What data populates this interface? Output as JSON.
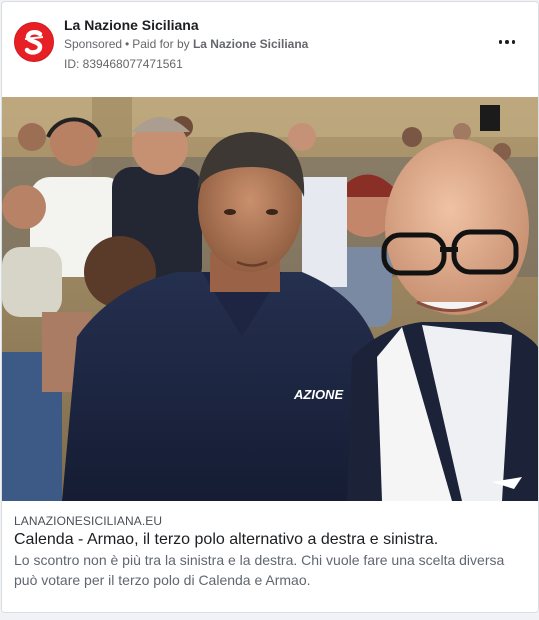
{
  "post": {
    "page_name": "La Nazione Siciliana",
    "sponsored_label": "Sponsored",
    "separator": "•",
    "paid_for_prefix": "Paid for by",
    "paid_for_by": "La Nazione Siciliana",
    "ad_id": "ID: 839468077471561",
    "more_icon": "more-horizontal-icon"
  },
  "photo": {
    "shirt_logo_text": "AZIONE"
  },
  "link": {
    "domain": "LANAZIONESICILIANA.EU",
    "headline": "Calenda - Armao, il terzo polo alternativo a destra e sinistra.",
    "description": "Lo scontro non è più tra la sinistra e la destra. Chi vuole fare una scelta diversa può votare per il terzo polo di Calenda e Armao."
  },
  "colors": {
    "brand_red": "#e62025",
    "text_primary": "#1c1e21",
    "text_secondary": "#65676b"
  }
}
